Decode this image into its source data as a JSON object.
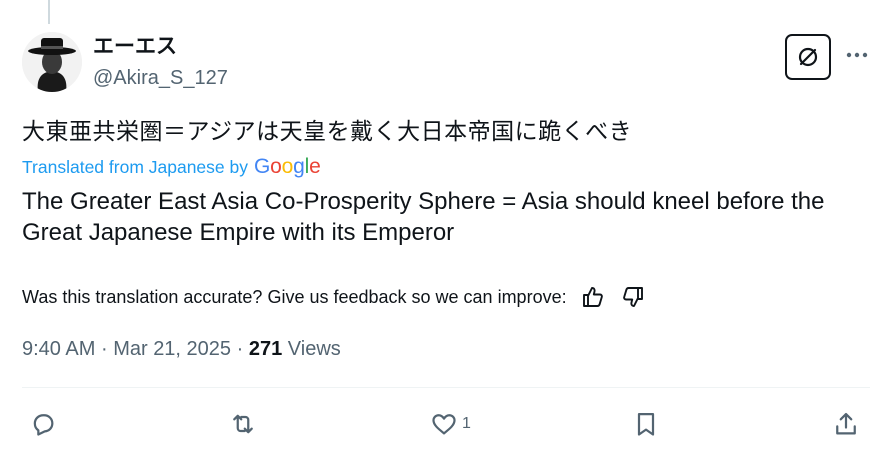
{
  "author": {
    "display_name": "エーエス",
    "handle": "@Akira_S_127"
  },
  "post": {
    "original_text": "大東亜共栄圏＝アジアは天皇を戴く大日本帝国に跪くべき",
    "translated_from": "Translated from Japanese by",
    "translation_provider": "Google",
    "translation_text": "The Greater East Asia Co-Prosperity Sphere = Asia should kneel before the Great Japanese Empire with its Emperor",
    "feedback_prompt": "Was this translation accurate? Give us feedback so we can improve:",
    "time": "9:40 AM",
    "date": "Mar 21, 2025",
    "views_count": "271",
    "views_label": "Views",
    "separator": "·"
  },
  "actions": {
    "like_count": "1"
  },
  "icons": {
    "grok": "grok-icon",
    "more": "more-icon",
    "thumbs_up": "thumbs-up-icon",
    "thumbs_down": "thumbs-down-icon",
    "reply": "reply-icon",
    "repost": "repost-icon",
    "like": "heart-icon",
    "bookmark": "bookmark-icon",
    "share": "share-icon"
  },
  "colors": {
    "link_blue": "#1d9bf0",
    "secondary_text": "#536471",
    "primary_text": "#0f1419",
    "google_blue": "#4285F4",
    "google_red": "#EA4335",
    "google_yellow": "#FBBC05",
    "google_green": "#34A853"
  }
}
